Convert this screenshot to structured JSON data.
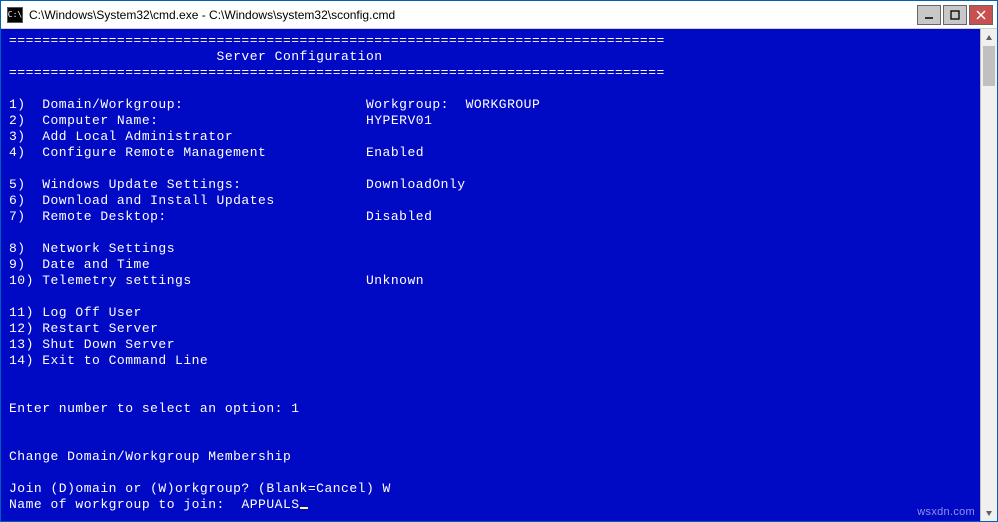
{
  "titlebar": {
    "icon_glyph": "C:\\",
    "text": "C:\\Windows\\System32\\cmd.exe - C:\\Windows\\system32\\sconfig.cmd"
  },
  "controls": {
    "minimize": "minimize-icon",
    "maximize": "maximize-icon",
    "close": "close-icon"
  },
  "rule": "===============================================================================",
  "header": "                         Server Configuration",
  "options": [
    {
      "num": "1)",
      "label": "Domain/Workgroup:",
      "value": "Workgroup:  WORKGROUP"
    },
    {
      "num": "2)",
      "label": "Computer Name:",
      "value": "HYPERV01"
    },
    {
      "num": "3)",
      "label": "Add Local Administrator",
      "value": ""
    },
    {
      "num": "4)",
      "label": "Configure Remote Management",
      "value": "Enabled"
    },
    {
      "num": "",
      "label": "",
      "value": ""
    },
    {
      "num": "5)",
      "label": "Windows Update Settings:",
      "value": "DownloadOnly"
    },
    {
      "num": "6)",
      "label": "Download and Install Updates",
      "value": ""
    },
    {
      "num": "7)",
      "label": "Remote Desktop:",
      "value": "Disabled"
    },
    {
      "num": "",
      "label": "",
      "value": ""
    },
    {
      "num": "8)",
      "label": "Network Settings",
      "value": ""
    },
    {
      "num": "9)",
      "label": "Date and Time",
      "value": ""
    },
    {
      "num": "10)",
      "label": "Telemetry settings",
      "value": "Unknown"
    },
    {
      "num": "",
      "label": "",
      "value": ""
    },
    {
      "num": "11)",
      "label": "Log Off User",
      "value": ""
    },
    {
      "num": "12)",
      "label": "Restart Server",
      "value": ""
    },
    {
      "num": "13)",
      "label": "Shut Down Server",
      "value": ""
    },
    {
      "num": "14)",
      "label": "Exit to Command Line",
      "value": ""
    }
  ],
  "prompt_select": "Enter number to select an option: 1",
  "section_change": "Change Domain/Workgroup Membership",
  "prompt_join": "Join (D)omain or (W)orkgroup? (Blank=Cancel) W",
  "prompt_workgroup_label": "Name of workgroup to join:  ",
  "prompt_workgroup_value": "APPUALS",
  "watermark": "wsxdn.com"
}
